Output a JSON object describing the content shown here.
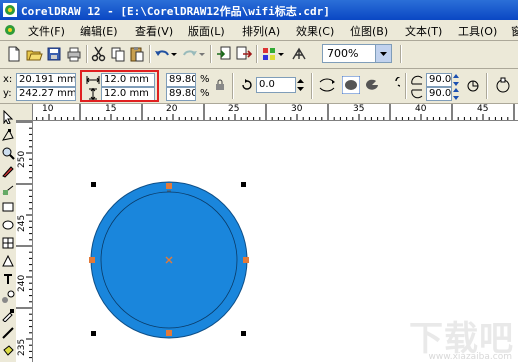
{
  "window": {
    "title": "CorelDRAW 12 - [E:\\CorelDRAW12作品\\wifi标志.cdr]"
  },
  "menu": {
    "items": [
      "文件(F)",
      "编辑(E)",
      "查看(V)",
      "版面(L)",
      "排列(A)",
      "效果(C)",
      "位图(B)",
      "文本(T)",
      "工具(O)",
      "窗"
    ]
  },
  "toolbar": {
    "zoom_value": "700%"
  },
  "property_bar": {
    "x_label": "x:",
    "x_value": "20.191 mm",
    "y_label": "y:",
    "y_value": "242.27 mm",
    "width_value": "12.0 mm",
    "height_value": "12.0 mm",
    "scale_x": "89.80",
    "scale_y": "89.80",
    "percent_x": "%",
    "percent_y": "%",
    "rotation_value": "0.0",
    "angle_start": "90.0",
    "angle_end": "90.0"
  },
  "rulers": {
    "horizontal_ticks": [
      "10",
      "15",
      "20",
      "25",
      "30",
      "35",
      "40",
      "45"
    ],
    "vertical_ticks": [
      "250",
      "245",
      "240",
      "235"
    ]
  },
  "watermark": {
    "text": "下载吧",
    "url": "www.xiazaiba.com"
  },
  "colors": {
    "circle_fill": "#1a86dc",
    "node_orange": "#e27a3a",
    "titlebar": "#0a47c4",
    "highlight": "#e02020"
  }
}
